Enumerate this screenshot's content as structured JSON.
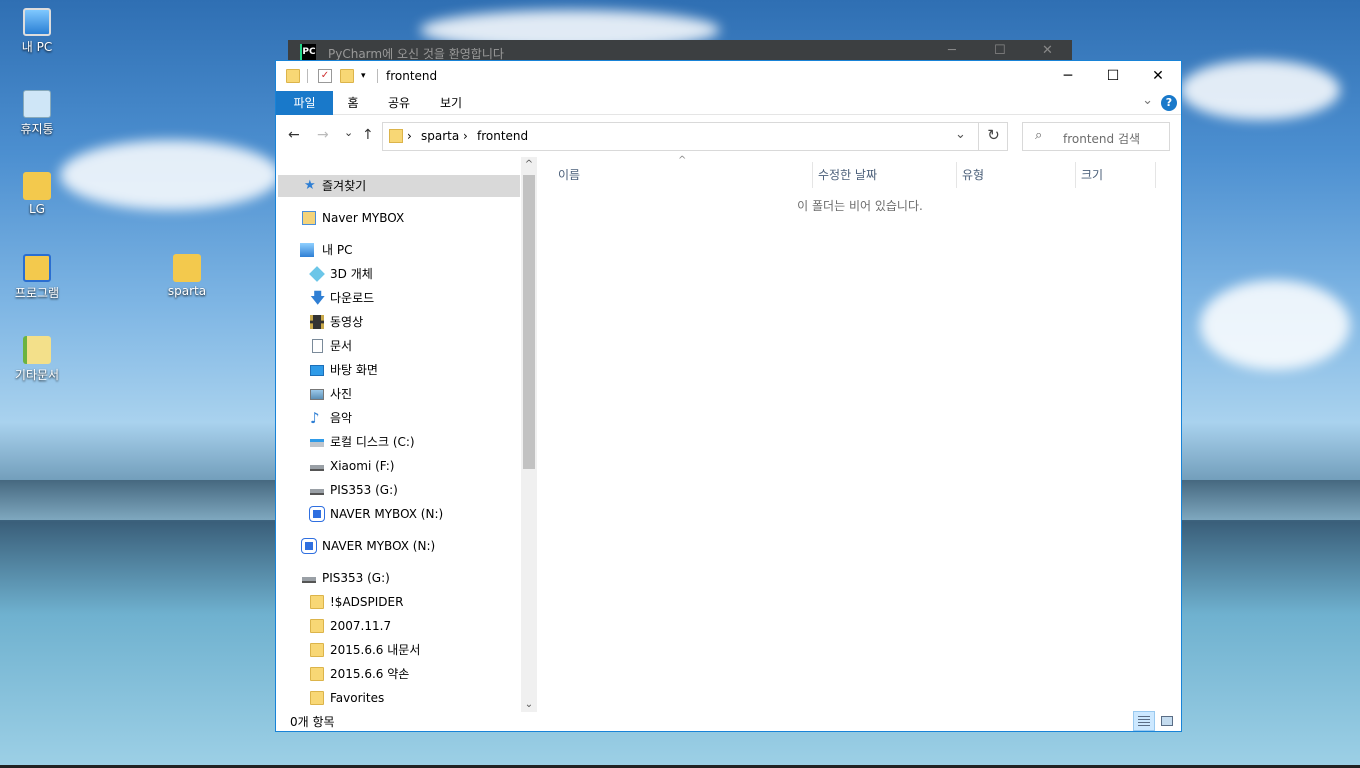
{
  "desktop": {
    "icons": [
      {
        "label": "내 PC"
      },
      {
        "label": "휴지통"
      },
      {
        "label": "LG"
      },
      {
        "label": "프로그램"
      },
      {
        "label": "sparta"
      },
      {
        "label": "기타문서"
      }
    ]
  },
  "pycharm": {
    "title": "PyCharm에 오신 것을 환영합니다"
  },
  "window": {
    "title": "frontend",
    "minimize": "─",
    "maximize": "☐",
    "close": "✕"
  },
  "ribbon": {
    "tabs": [
      "파일",
      "홈",
      "공유",
      "보기"
    ],
    "expand_icon": "⌄",
    "help": "?"
  },
  "navigation": {
    "back": "←",
    "forward": "→",
    "recent": "⌄",
    "up": "↑",
    "breadcrumb": [
      "sparta",
      "frontend"
    ],
    "separator": "›",
    "dropdown": "⌄",
    "refresh": "↻",
    "search_placeholder": "frontend 검색",
    "search_icon": "⌕"
  },
  "nav_pane": {
    "items": [
      {
        "label": "즐겨찾기",
        "icon": "star-icon"
      },
      {
        "label": "Naver MYBOX",
        "icon": "mybox-folder-icon"
      },
      {
        "label": "내 PC",
        "icon": "computer-icon"
      },
      {
        "label": "3D 개체",
        "icon": "3d-objects-icon"
      },
      {
        "label": "다운로드",
        "icon": "download-icon"
      },
      {
        "label": "동영상",
        "icon": "video-icon"
      },
      {
        "label": "문서",
        "icon": "document-icon"
      },
      {
        "label": "바탕 화면",
        "icon": "desktop-icon"
      },
      {
        "label": "사진",
        "icon": "pictures-icon"
      },
      {
        "label": "음악",
        "icon": "music-icon"
      },
      {
        "label": "로컬 디스크 (C:)",
        "icon": "local-disk-icon"
      },
      {
        "label": "Xiaomi (F:)",
        "icon": "drive-icon"
      },
      {
        "label": "PIS353 (G:)",
        "icon": "drive-icon"
      },
      {
        "label": "NAVER MYBOX (N:)",
        "icon": "mybox-drive-icon"
      },
      {
        "label": "NAVER MYBOX (N:)",
        "icon": "mybox-drive-icon"
      },
      {
        "label": "PIS353 (G:)",
        "icon": "drive-icon"
      },
      {
        "label": "!$ADSPIDER",
        "icon": "folder-icon"
      },
      {
        "label": "2007.11.7",
        "icon": "folder-icon"
      },
      {
        "label": "2015.6.6 내문서",
        "icon": "folder-icon"
      },
      {
        "label": "2015.6.6 약손",
        "icon": "folder-icon"
      },
      {
        "label": "Favorites",
        "icon": "folder-icon"
      }
    ],
    "scroll_up": "^",
    "scroll_down": "⌄"
  },
  "content": {
    "columns": [
      "이름",
      "수정한 날짜",
      "유형",
      "크기"
    ],
    "sort_indicator": "^",
    "empty_message": "이 폴더는 비어 있습니다."
  },
  "status": {
    "item_count": "0개 항목"
  },
  "colors": {
    "accent": "#1979ca",
    "window_border": "#1883d7",
    "selected_nav": "#d9d9d9"
  }
}
